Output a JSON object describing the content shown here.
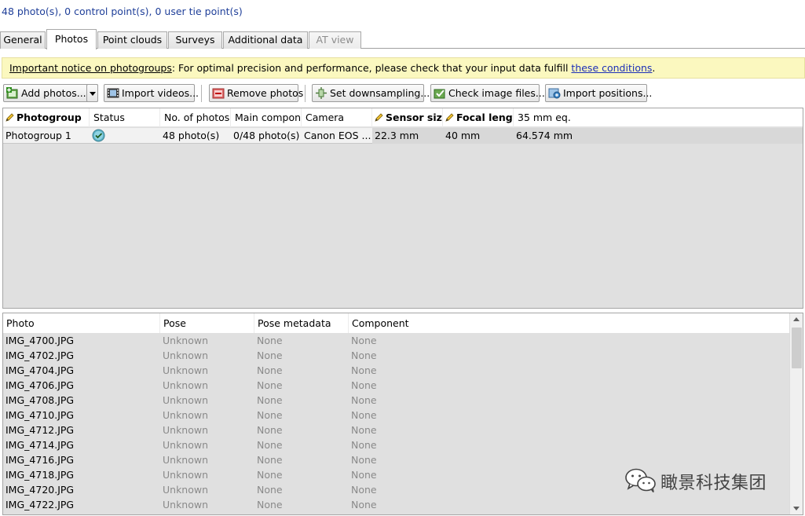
{
  "summary": "48 photo(s), 0 control point(s), 0 user tie point(s)",
  "tabs": [
    {
      "label": "General",
      "state": "normal"
    },
    {
      "label": "Photos",
      "state": "active"
    },
    {
      "label": "Point clouds",
      "state": "normal"
    },
    {
      "label": "Surveys",
      "state": "normal"
    },
    {
      "label": "Additional data",
      "state": "normal"
    },
    {
      "label": "AT view",
      "state": "disabled"
    }
  ],
  "notice": {
    "title": "Important notice on photogroups",
    "text": ": For optimal precision and performance, please check that your input data fulfill ",
    "link": "these conditions",
    "end": "."
  },
  "toolbar": {
    "add_photos": "Add photos...",
    "import_videos": "Import videos...",
    "remove_photos": "Remove photos",
    "set_downsampling": "Set downsampling...",
    "check_image_files": "Check image files...",
    "import_positions": "Import positions..."
  },
  "photogroups": {
    "columns": [
      "Photogroup",
      "Status",
      "No. of photos",
      "Main compon",
      "Camera",
      "Sensor size",
      "Focal lengt",
      "35 mm eq."
    ],
    "rows": [
      {
        "photogroup": "Photogroup 1",
        "status_icon": "check-circle-icon",
        "no_of_photos": "48 photo(s)",
        "main_component": "0/48 photo(s)",
        "camera": "Canon EOS ...",
        "sensor_size": "22.3 mm",
        "focal_length": "40 mm",
        "mm35_eq": "64.574 mm"
      }
    ]
  },
  "photos": {
    "columns": [
      "Photo",
      "Pose",
      "Pose metadata",
      "Component"
    ],
    "rows": [
      {
        "photo": "IMG_4700.JPG",
        "pose": "Unknown",
        "pose_metadata": "None",
        "component": "None"
      },
      {
        "photo": "IMG_4702.JPG",
        "pose": "Unknown",
        "pose_metadata": "None",
        "component": "None"
      },
      {
        "photo": "IMG_4704.JPG",
        "pose": "Unknown",
        "pose_metadata": "None",
        "component": "None"
      },
      {
        "photo": "IMG_4706.JPG",
        "pose": "Unknown",
        "pose_metadata": "None",
        "component": "None"
      },
      {
        "photo": "IMG_4708.JPG",
        "pose": "Unknown",
        "pose_metadata": "None",
        "component": "None"
      },
      {
        "photo": "IMG_4710.JPG",
        "pose": "Unknown",
        "pose_metadata": "None",
        "component": "None"
      },
      {
        "photo": "IMG_4712.JPG",
        "pose": "Unknown",
        "pose_metadata": "None",
        "component": "None"
      },
      {
        "photo": "IMG_4714.JPG",
        "pose": "Unknown",
        "pose_metadata": "None",
        "component": "None"
      },
      {
        "photo": "IMG_4716.JPG",
        "pose": "Unknown",
        "pose_metadata": "None",
        "component": "None"
      },
      {
        "photo": "IMG_4718.JPG",
        "pose": "Unknown",
        "pose_metadata": "None",
        "component": "None"
      },
      {
        "photo": "IMG_4720.JPG",
        "pose": "Unknown",
        "pose_metadata": "None",
        "component": "None"
      },
      {
        "photo": "IMG_4722.JPG",
        "pose": "Unknown",
        "pose_metadata": "None",
        "component": "None"
      }
    ]
  },
  "watermark": {
    "text": "瞰景科技集团",
    "icon": "wechat-icon"
  },
  "colors": {
    "notice_bg": "#fbf8bf",
    "link": "#1c2fb8",
    "summary": "#1f3f99",
    "grid_bg": "#e0e0e0"
  }
}
